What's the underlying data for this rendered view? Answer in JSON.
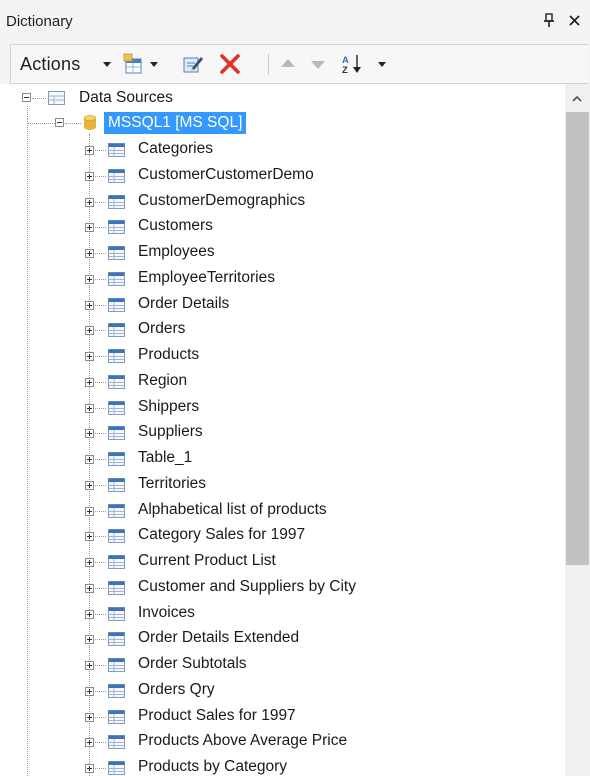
{
  "panel": {
    "title": "Dictionary",
    "pin_icon": "pin-icon",
    "close_icon": "close-icon"
  },
  "toolbar": {
    "actions_label": "Actions",
    "icons": [
      "new-item-icon",
      "edit-icon",
      "delete-icon",
      "move-up-icon",
      "move-down-icon",
      "sort-az-icon"
    ]
  },
  "tree": {
    "root": {
      "label": "Data Sources",
      "expanded": true
    },
    "connection": {
      "label": "MSSQL1 [MS SQL]",
      "expanded": true,
      "selected": true
    },
    "items": [
      "Categories",
      "CustomerCustomerDemo",
      "CustomerDemographics",
      "Customers",
      "Employees",
      "EmployeeTerritories",
      "Order Details",
      "Orders",
      "Products",
      "Region",
      "Shippers",
      "Suppliers",
      "Table_1",
      "Territories",
      "Alphabetical list of products",
      "Category Sales for 1997",
      "Current Product List",
      "Customer and Suppliers by City",
      "Invoices",
      "Order Details Extended",
      "Order Subtotals",
      "Orders Qry",
      "Product Sales for 1997",
      "Products Above Average Price",
      "Products by Category"
    ]
  },
  "colors": {
    "selection": "#3399ff",
    "delete_icon": "#e0302a",
    "table_icon_header": "#2f6fb8",
    "database_icon": "#e9b23a"
  }
}
